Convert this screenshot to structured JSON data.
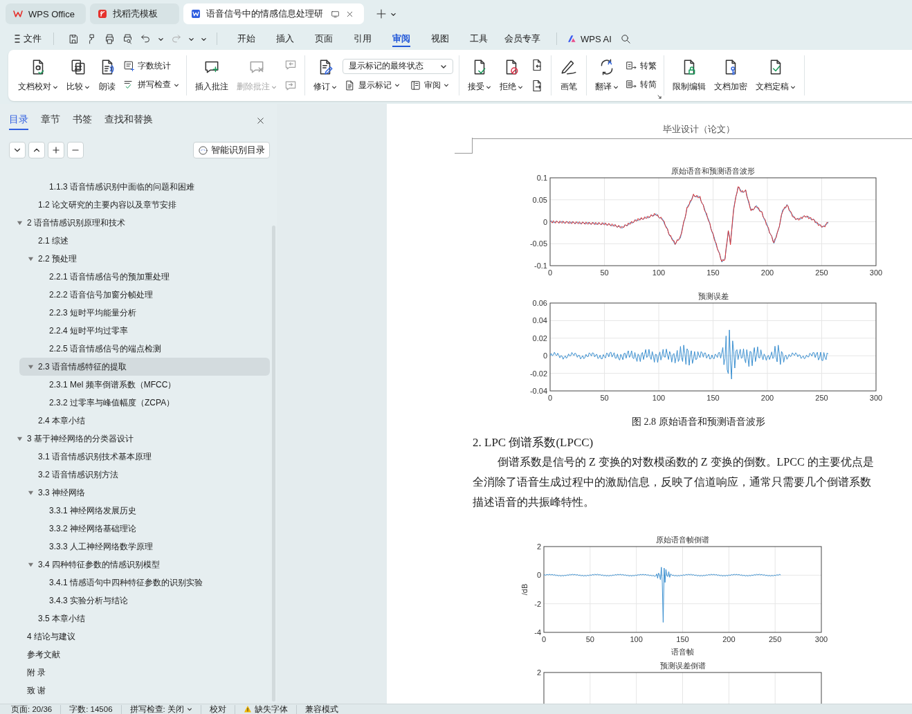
{
  "tabs": [
    {
      "label": "WPS Office",
      "selected": false
    },
    {
      "label": "找稻壳模板",
      "selected": false
    },
    {
      "label": "语音信号中的情感信息处理研",
      "selected": true
    }
  ],
  "menu": {
    "file": "文件",
    "tabs": [
      {
        "label": "开始",
        "selected": false
      },
      {
        "label": "插入",
        "selected": false
      },
      {
        "label": "页面",
        "selected": false
      },
      {
        "label": "引用",
        "selected": false
      },
      {
        "label": "审阅",
        "selected": true
      },
      {
        "label": "视图",
        "selected": false
      },
      {
        "label": "工具",
        "selected": false
      },
      {
        "label": "会员专享",
        "selected": false
      }
    ],
    "ai": "WPS AI"
  },
  "ribbon": [
    {
      "items": [
        {
          "kind": "large",
          "label": "文档校对",
          "dropdown": true,
          "disabled": false
        },
        {
          "kind": "large",
          "label": "比较",
          "dropdown": true,
          "disabled": false
        },
        {
          "kind": "large",
          "label": "朗读",
          "dropdown": false,
          "disabled": false
        },
        {
          "kind": "stack",
          "rows": [
            [
              {
                "kind": "button",
                "label": "字数统计",
                "dropdown": false,
                "disabled": false
              }
            ],
            [
              {
                "kind": "button",
                "label": "拼写检查",
                "dropdown": true,
                "disabled": false
              }
            ]
          ]
        }
      ]
    },
    {
      "items": [
        {
          "kind": "large",
          "label": "插入批注",
          "dropdown": false,
          "disabled": false
        },
        {
          "kind": "large",
          "label": "删除批注",
          "dropdown": true,
          "disabled": true
        },
        {
          "kind": "stack",
          "rows": [
            [
              {
                "kind": "icon",
                "disabled": true
              }
            ],
            [
              {
                "kind": "icon",
                "disabled": true
              }
            ]
          ]
        }
      ]
    },
    {
      "items": [
        {
          "kind": "large",
          "label": "修订",
          "dropdown": true,
          "disabled": false
        },
        {
          "kind": "stack",
          "rows": [
            [
              {
                "kind": "select",
                "value": "显示标记的最终状态"
              }
            ],
            [
              {
                "kind": "button",
                "label": "显示标记",
                "dropdown": true,
                "disabled": false
              },
              {
                "kind": "button",
                "label": "审阅",
                "dropdown": true,
                "disabled": false
              }
            ]
          ]
        }
      ]
    },
    {
      "items": [
        {
          "kind": "large",
          "label": "接受",
          "dropdown": true,
          "disabled": false
        },
        {
          "kind": "large",
          "label": "拒绝",
          "dropdown": true,
          "disabled": false
        },
        {
          "kind": "stack",
          "rows": [
            [
              {
                "kind": "icon",
                "disabled": false
              }
            ],
            [
              {
                "kind": "icon",
                "disabled": false
              }
            ]
          ]
        }
      ]
    },
    {
      "items": [
        {
          "kind": "large",
          "label": "画笔",
          "dropdown": false,
          "disabled": false
        }
      ]
    },
    {
      "launcher": true,
      "items": [
        {
          "kind": "large",
          "label": "翻译",
          "dropdown": true,
          "disabled": false
        },
        {
          "kind": "stack",
          "rows": [
            [
              {
                "kind": "button",
                "label": "转繁",
                "dropdown": false,
                "disabled": false
              }
            ],
            [
              {
                "kind": "button",
                "label": "转简",
                "dropdown": false,
                "disabled": false
              }
            ]
          ]
        }
      ]
    },
    {
      "items": [
        {
          "kind": "large",
          "label": "限制编辑",
          "dropdown": false,
          "disabled": false
        },
        {
          "kind": "large",
          "label": "文档加密",
          "dropdown": false,
          "disabled": false
        },
        {
          "kind": "large",
          "label": "文档定稿",
          "dropdown": true,
          "disabled": false
        }
      ]
    }
  ],
  "navigation": {
    "tabs": [
      {
        "label": "目录",
        "selected": true
      },
      {
        "label": "章节",
        "selected": false
      },
      {
        "label": "书签",
        "selected": false
      },
      {
        "label": "查找和替换",
        "selected": false
      }
    ],
    "smart_button": "智能识别目录",
    "tree": [
      {
        "children": [
          {
            "children": [
              {
                "label": "1.1.3 语音情感识别中面临的问题和困难",
                "selected": false
              }
            ]
          },
          {
            "label": "1.2 论文研究的主要内容以及章节安排",
            "selected": false
          }
        ]
      },
      {
        "label": "2  语音情感识别原理和技术",
        "selected": false,
        "expanded": true,
        "children": [
          {
            "label": "2.1 综述",
            "selected": false
          },
          {
            "label": "2.2  预处理",
            "selected": false,
            "expanded": true,
            "children": [
              {
                "label": "2.2.1 语音情感信号的预加重处理",
                "selected": false
              },
              {
                "label": "2.2.2 语音信号加窗分帧处理",
                "selected": false
              },
              {
                "label": "2.2.3  短时平均能量分析",
                "selected": false
              },
              {
                "label": "2.2.4  短时平均过零率",
                "selected": false
              },
              {
                "label": "2.2.5  语音情感信号的端点检测",
                "selected": false
              }
            ]
          },
          {
            "label": "2.3 语音情感特征的提取",
            "selected": true,
            "expanded": true,
            "children": [
              {
                "label": "2.3.1 Mel 频率倒谱系数（MFCC）",
                "selected": false
              },
              {
                "label": "2.3.2 过零率与峰值幅度（ZCPA）",
                "selected": false
              }
            ]
          },
          {
            "label": "2.4 本章小结",
            "selected": false
          }
        ]
      },
      {
        "label": "3  基于神经网络的分类器设计",
        "selected": false,
        "expanded": true,
        "children": [
          {
            "label": "3.1  语音情感识别技术基本原理",
            "selected": false
          },
          {
            "label": "3.2 语音情感识别方法",
            "selected": false
          },
          {
            "label": "3.3 神经网络",
            "selected": false,
            "expanded": true,
            "children": [
              {
                "label": "3.3.1 神经网络发展历史",
                "selected": false
              },
              {
                "label": "3.3.2 神经网络基础理论",
                "selected": false
              },
              {
                "label": "3.3.3 人工神经网络数学原理",
                "selected": false
              }
            ]
          },
          {
            "label": "3.4 四种特征参数的情感识别模型",
            "selected": false,
            "expanded": true,
            "children": [
              {
                "label": "3.4.1 情感语句中四种特征参数的识别实验",
                "selected": false
              },
              {
                "label": "3.4.3 实验分析与结论",
                "selected": false
              }
            ]
          },
          {
            "label": "3.5 本章小结",
            "selected": false
          }
        ]
      },
      {
        "label": "4  结论与建议",
        "selected": false
      },
      {
        "label": "参考文献",
        "selected": false
      },
      {
        "label": "附  录",
        "selected": false
      },
      {
        "label": "致  谢",
        "selected": false
      }
    ]
  },
  "document": {
    "header": "毕业设计（论文）",
    "blocks": [
      {
        "kind": "figure",
        "plots": [
          {
            "kind": "speech",
            "title": "原始语音和预测语音波形",
            "yticks": [
              "0.1",
              "0.05",
              "0",
              "-0.05",
              "-0.1"
            ],
            "xticks": [
              "0",
              "50",
              "100",
              "150",
              "200",
              "250",
              "300"
            ]
          },
          {
            "kind": "error",
            "title": "预测误差",
            "yticks": [
              "0.06",
              "0.04",
              "0.02",
              "0",
              "-0.02",
              "-0.04"
            ],
            "xticks": [
              "0",
              "50",
              "100",
              "150",
              "200",
              "250",
              "300"
            ]
          }
        ]
      },
      {
        "kind": "caption",
        "text": "图 2.8  原始语音和预测语音波形"
      },
      {
        "kind": "heading",
        "text": "2. LPC 倒谱系数(LPCC)"
      },
      {
        "kind": "paragraph",
        "lines": [
          "倒谱系数是信号的 Z 变换的对数模函数的 Z 变换的倒数。LPCC 的主要优点是",
          "全消除了语音生成过程中的激励信息，反映了信道响应，通常只需要几个倒谱系数",
          "描述语音的共振峰特性。"
        ]
      },
      {
        "kind": "figure",
        "plots": [
          {
            "kind": "cepstrum",
            "title": "原始语音帧倒谱",
            "yticks": [
              "2",
              "0",
              "-2",
              "-4"
            ],
            "xticks": [
              "0",
              "50",
              "100",
              "150",
              "200",
              "250",
              "300"
            ],
            "xlabel": "语音帧",
            "ylabel": "/dB"
          },
          {
            "kind": "empty",
            "title": "预测误差倒谱",
            "yticks": [
              "2"
            ]
          }
        ]
      }
    ]
  },
  "status_bar": [
    {
      "kind": "text",
      "label": "页面: 20/36"
    },
    {
      "kind": "text",
      "label": "字数: 14506"
    },
    {
      "kind": "dropdown",
      "label": "拼写检查: 关闭"
    },
    {
      "kind": "text",
      "label": "校对"
    },
    {
      "kind": "warning",
      "label": "缺失字体"
    },
    {
      "kind": "text",
      "label": "兼容模式"
    }
  ]
}
